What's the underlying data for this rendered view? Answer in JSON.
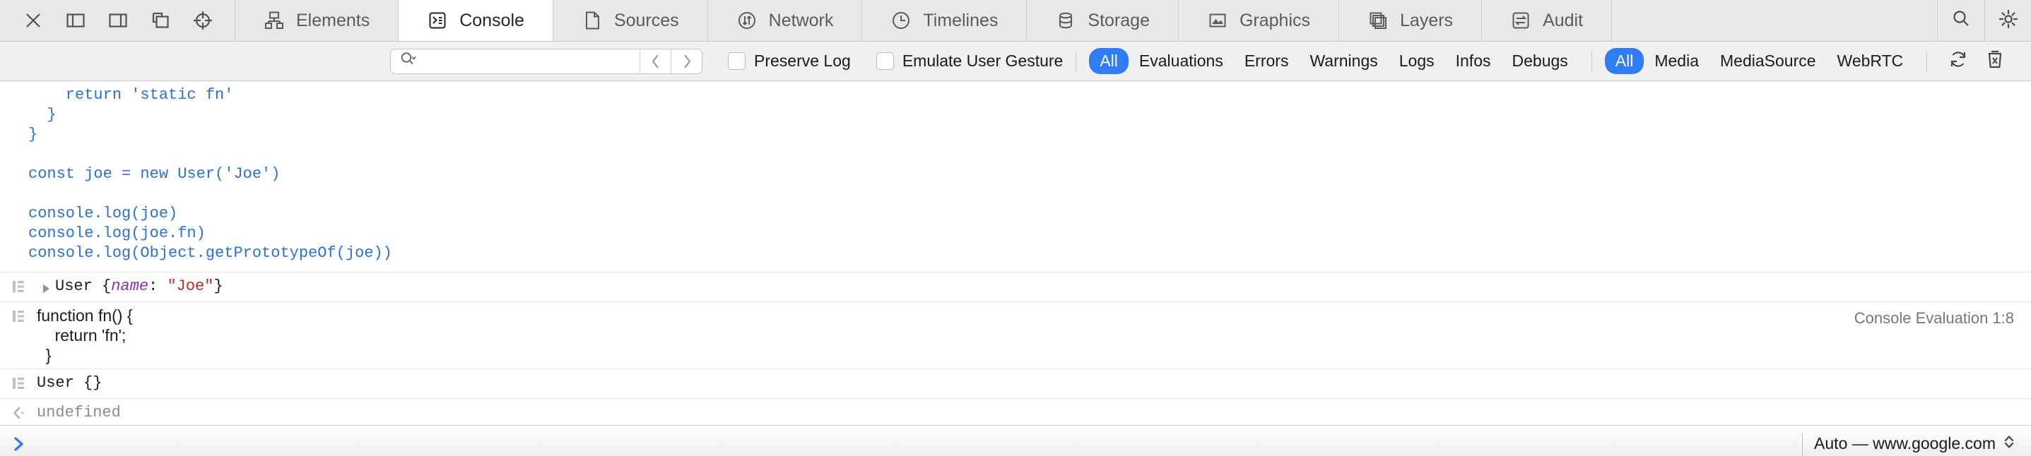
{
  "toolbar": {
    "window_buttons": [
      {
        "name": "close-inspector-button",
        "icon": "close-icon"
      },
      {
        "name": "dock-left-button",
        "icon": "dock-left-icon"
      },
      {
        "name": "dock-right-button",
        "icon": "dock-right-icon"
      },
      {
        "name": "undock-window-button",
        "icon": "detach-window-icon"
      },
      {
        "name": "inspect-element-button",
        "icon": "crosshair-target-icon"
      }
    ],
    "tabs": [
      {
        "label": "Elements",
        "icon": "elements-tree-icon",
        "active": false
      },
      {
        "label": "Console",
        "icon": "console-prompt-icon",
        "active": true
      },
      {
        "label": "Sources",
        "icon": "document-page-icon",
        "active": false
      },
      {
        "label": "Network",
        "icon": "network-arrows-icon",
        "active": false
      },
      {
        "label": "Timelines",
        "icon": "clock-icon",
        "active": false
      },
      {
        "label": "Storage",
        "icon": "database-icon",
        "active": false
      },
      {
        "label": "Graphics",
        "icon": "image-picture-icon",
        "active": false
      },
      {
        "label": "Layers",
        "icon": "layers-stack-icon",
        "active": false
      },
      {
        "label": "Audit",
        "icon": "audit-swap-icon",
        "active": false
      }
    ],
    "right_tools": [
      {
        "name": "search-inspector-button",
        "icon": "search-icon"
      },
      {
        "name": "inspector-settings-button",
        "icon": "gear-icon"
      }
    ]
  },
  "filterbar": {
    "search": {
      "value": "",
      "placeholder": ""
    },
    "search_icon": "search-magnifier-icon",
    "prev_button_icon": "chevron-left-icon",
    "next_button_icon": "chevron-right-icon",
    "checkboxes": [
      {
        "label": "Preserve Log",
        "checked": false
      },
      {
        "label": "Emulate User Gesture",
        "checked": false
      }
    ],
    "level_filters": [
      {
        "label": "All",
        "selected": true
      },
      {
        "label": "Evaluations",
        "selected": false
      },
      {
        "label": "Errors",
        "selected": false
      },
      {
        "label": "Warnings",
        "selected": false
      },
      {
        "label": "Logs",
        "selected": false
      },
      {
        "label": "Infos",
        "selected": false
      },
      {
        "label": "Debugs",
        "selected": false
      }
    ],
    "source_filters": [
      {
        "label": "All",
        "selected": true
      },
      {
        "label": "Media",
        "selected": false
      },
      {
        "label": "MediaSource",
        "selected": false
      },
      {
        "label": "WebRTC",
        "selected": false
      }
    ],
    "actions": [
      {
        "name": "reload-preserve-button",
        "icon": "circular-arrows-icon"
      },
      {
        "name": "clear-console-button",
        "icon": "trash-icon"
      }
    ],
    "accent_color": "#2f7cf6"
  },
  "console": {
    "evaluated_code": "    return 'static fn'\n  }\n}\n\nconst joe = new User('Joe')\n\nconsole.log(joe)\nconsole.log(joe.fn)\nconsole.log(Object.getPrototypeOf(joe))",
    "messages": [
      {
        "gutter_icon": "source-list-icon",
        "has_disclosure": true,
        "disclosure_icon": "triangle-right-icon",
        "monospace": true,
        "parts": [
          {
            "text": "User ",
            "type": "plain"
          },
          {
            "text": "{",
            "type": "punct"
          },
          {
            "text": "name",
            "type": "prop"
          },
          {
            "text": ": ",
            "type": "punct"
          },
          {
            "text": "\"Joe\"",
            "type": "string"
          },
          {
            "text": "}",
            "type": "punct"
          }
        ],
        "source": ""
      },
      {
        "gutter_icon": "source-list-icon",
        "has_disclosure": false,
        "monospace": false,
        "parts": [
          {
            "text": "function fn() {\n    return 'fn';\n  }",
            "type": "plain"
          }
        ],
        "source": "Console Evaluation 1:8"
      },
      {
        "gutter_icon": "source-list-icon",
        "has_disclosure": false,
        "monospace": true,
        "parts": [
          {
            "text": "User {}",
            "type": "plain"
          }
        ],
        "source": ""
      },
      {
        "gutter_icon": "return-arrow-icon",
        "has_disclosure": false,
        "monospace": true,
        "is_result": true,
        "parts": [
          {
            "text": "undefined",
            "type": "plain"
          }
        ],
        "source": ""
      }
    ]
  },
  "prompt": {
    "chevron_icon": "chevron-right-prompt-icon",
    "value": "",
    "placeholder": "",
    "context_label": "Auto — www.google.com",
    "context_icon": "up-down-chevron-icon"
  }
}
